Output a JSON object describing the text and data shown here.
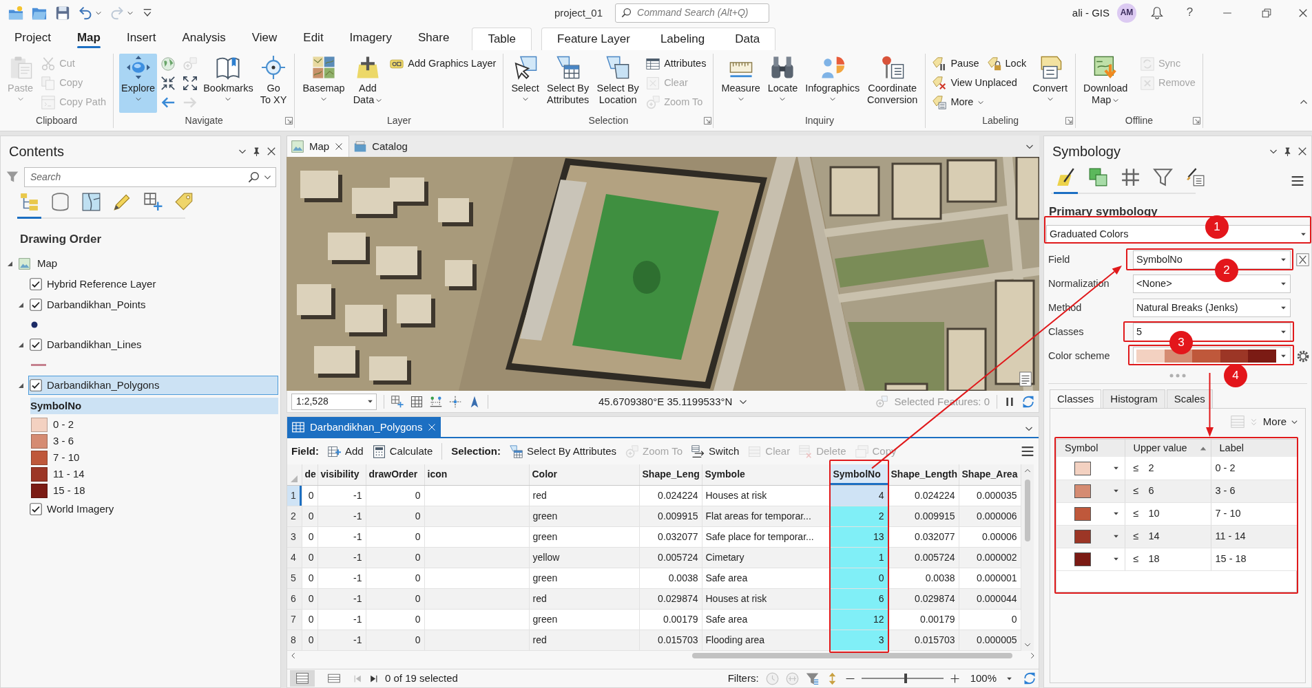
{
  "title_bar": {
    "project": "project_01",
    "command_search": {
      "placeholder": "Command Search (Alt+Q)"
    },
    "user": "ali - GIS",
    "avatar": "AM",
    "help": "?"
  },
  "ribbon_tabs": [
    {
      "label": "Project",
      "selected": false
    },
    {
      "label": "Map",
      "selected": true
    },
    {
      "label": "Insert",
      "selected": false
    },
    {
      "label": "Analysis",
      "selected": false
    },
    {
      "label": "View",
      "selected": false
    },
    {
      "label": "Edit",
      "selected": false
    },
    {
      "label": "Imagery",
      "selected": false
    },
    {
      "label": "Share",
      "selected": false
    }
  ],
  "contextual_tab_groups": [
    [
      {
        "label": "Table",
        "selected": false
      }
    ],
    [
      {
        "label": "Feature Layer",
        "selected": false
      },
      {
        "label": "Labeling",
        "selected": false
      },
      {
        "label": "Data",
        "selected": false
      }
    ]
  ],
  "ribbon_groups": [
    {
      "name": "Clipboard",
      "launcher": false,
      "items": [
        {
          "kind": "large",
          "label": "Paste",
          "disabled": true,
          "active": false,
          "dropdown": true
        },
        {
          "kind": "stack",
          "rows": [
            [
              {
                "label": "Cut",
                "disabled": true
              }
            ],
            [
              {
                "label": "Copy",
                "disabled": true
              }
            ],
            [
              {
                "label": "Copy Path",
                "disabled": true
              }
            ]
          ]
        }
      ]
    },
    {
      "name": "Navigate",
      "launcher": true,
      "items": [
        {
          "kind": "large",
          "label": "Explore",
          "disabled": false,
          "active": true,
          "dropdown": true
        },
        {
          "kind": "stack",
          "rows": [
            [
              {
                "disabled": false
              },
              {
                "disabled": true
              }
            ],
            [
              {
                "disabled": false
              },
              {
                "disabled": false
              }
            ],
            [
              {
                "disabled": false
              },
              {
                "disabled": true
              }
            ]
          ]
        },
        {
          "kind": "large",
          "label": "Bookmarks",
          "disabled": false,
          "active": false,
          "dropdown": true
        },
        {
          "kind": "large",
          "label": "Go\nTo XY",
          "disabled": false,
          "active": false,
          "dropdown": false
        }
      ]
    },
    {
      "name": "Layer",
      "launcher": false,
      "items": [
        {
          "kind": "large",
          "label": "Basemap",
          "disabled": false,
          "active": false,
          "dropdown": true
        },
        {
          "kind": "large",
          "label": "Add\nData",
          "disabled": false,
          "active": false,
          "dropdown": true
        },
        {
          "kind": "stack",
          "rows": [
            [
              {
                "label": "Add Graphics Layer",
                "disabled": false
              }
            ]
          ]
        }
      ]
    },
    {
      "name": "Selection",
      "launcher": true,
      "items": [
        {
          "kind": "large",
          "label": "Select",
          "disabled": false,
          "active": false,
          "dropdown": true
        },
        {
          "kind": "large",
          "label": "Select By\nAttributes",
          "disabled": false,
          "active": false,
          "dropdown": false
        },
        {
          "kind": "large",
          "label": "Select By\nLocation",
          "disabled": false,
          "active": false,
          "dropdown": false
        },
        {
          "kind": "stack",
          "rows": [
            [
              {
                "label": "Attributes",
                "disabled": false
              }
            ],
            [
              {
                "label": "Clear",
                "disabled": true
              }
            ],
            [
              {
                "label": "Zoom To",
                "disabled": true
              }
            ]
          ]
        }
      ]
    },
    {
      "name": "Inquiry",
      "launcher": false,
      "items": [
        {
          "kind": "large",
          "label": "Measure",
          "disabled": false,
          "active": false,
          "dropdown": true
        },
        {
          "kind": "large",
          "label": "Locate",
          "disabled": false,
          "active": false,
          "dropdown": true
        },
        {
          "kind": "large",
          "label": "Infographics",
          "disabled": false,
          "active": false,
          "dropdown": true
        },
        {
          "kind": "large",
          "label": "Coordinate\nConversion",
          "disabled": false,
          "active": false,
          "dropdown": false
        }
      ]
    },
    {
      "name": "Labeling",
      "launcher": true,
      "items": [
        {
          "kind": "stack",
          "rows": [
            [
              {
                "label": "Pause",
                "disabled": false
              },
              {
                "label": "Lock",
                "disabled": false
              }
            ],
            [
              {
                "label": "View Unplaced",
                "disabled": false
              }
            ],
            [
              {
                "label": "More",
                "disabled": false,
                "dropdown": true
              }
            ]
          ]
        },
        {
          "kind": "large",
          "label": "Convert",
          "disabled": false,
          "active": false,
          "dropdown": true
        }
      ]
    },
    {
      "name": "Offline",
      "launcher": true,
      "items": [
        {
          "kind": "large",
          "label": "Download\nMap",
          "disabled": false,
          "active": false,
          "dropdown": true
        },
        {
          "kind": "stack",
          "rows": [
            [
              {
                "label": "Sync",
                "disabled": true
              }
            ],
            [
              {
                "label": "Remove",
                "disabled": true
              }
            ]
          ]
        }
      ]
    }
  ],
  "contents": {
    "title": "Contents",
    "search": {
      "placeholder": "Search"
    },
    "view_tabs": [
      {
        "selected": true
      },
      {
        "selected": false
      },
      {
        "selected": false
      },
      {
        "selected": false
      },
      {
        "selected": false
      },
      {
        "selected": false
      }
    ],
    "heading": "Drawing Order",
    "tree": [
      {
        "name": "Map",
        "kind": "map",
        "expanded": true,
        "selected": false,
        "children": [
          {
            "name": "Hybrid Reference Layer",
            "kind": "layer",
            "checked": true,
            "selected": false
          },
          {
            "name": "Darbandikhan_Points",
            "kind": "layer",
            "checked": true,
            "expanded": true,
            "selected": false,
            "legend": {
              "kind": "point",
              "color": "#1c2b66"
            }
          },
          {
            "name": "Darbandikhan_Lines",
            "kind": "layer",
            "checked": true,
            "expanded": true,
            "selected": false,
            "legend": {
              "kind": "line",
              "color": "#c4808e"
            }
          },
          {
            "name": "Darbandikhan_Polygons",
            "kind": "layer",
            "checked": true,
            "expanded": true,
            "selected": true,
            "legend": {
              "kind": "classes",
              "field": "SymbolNo",
              "classes": [
                {
                  "label": "0 - 2",
                  "color": "#f3d1c1"
                },
                {
                  "label": "3 - 6",
                  "color": "#d58b72"
                },
                {
                  "label": "7 - 10",
                  "color": "#bf583b"
                },
                {
                  "label": "11 - 14",
                  "color": "#9c3626"
                },
                {
                  "label": "15 - 18",
                  "color": "#7b1b14"
                }
              ]
            }
          },
          {
            "name": "World Imagery",
            "kind": "layer",
            "checked": true,
            "selected": false
          }
        ]
      }
    ]
  },
  "map_view": {
    "tabs": [
      {
        "label": "Map",
        "selected": true,
        "closable": true
      },
      {
        "label": "Catalog",
        "selected": false,
        "closable": false
      }
    ],
    "scale": "1:2,528",
    "coordinates": "45.6709380°E 35.1199533°N",
    "selected_features": "Selected Features: 0"
  },
  "table_view": {
    "tab": {
      "label": "Darbandikhan_Polygons",
      "selected": true
    },
    "field_label": "Field:",
    "field_commands": [
      {
        "label": "Add",
        "disabled": false
      },
      {
        "label": "Calculate",
        "disabled": false
      }
    ],
    "selection_label": "Selection:",
    "selection_commands": [
      {
        "label": "Select By Attributes",
        "disabled": false
      },
      {
        "label": "Zoom To",
        "disabled": true
      },
      {
        "label": "Switch",
        "disabled": false
      },
      {
        "label": "Clear",
        "disabled": true
      },
      {
        "label": "Delete",
        "disabled": true
      },
      {
        "label": "Copy",
        "disabled": true
      }
    ],
    "columns": [
      {
        "label": "de",
        "kind": "number",
        "selected": false,
        "highlighted": false
      },
      {
        "label": "visibility",
        "kind": "number",
        "selected": false,
        "highlighted": false
      },
      {
        "label": "drawOrder",
        "kind": "number",
        "selected": false,
        "highlighted": false
      },
      {
        "label": "icon",
        "kind": "text",
        "selected": false,
        "highlighted": false
      },
      {
        "label": "Color",
        "kind": "text",
        "selected": false,
        "highlighted": false
      },
      {
        "label": "Shape_Leng",
        "kind": "number",
        "selected": false,
        "highlighted": false
      },
      {
        "label": "Symbole",
        "kind": "text",
        "selected": false,
        "highlighted": false
      },
      {
        "label": "SymbolNo",
        "kind": "number",
        "selected": true,
        "highlighted": true,
        "arrow": true
      },
      {
        "label": "Shape_Length",
        "kind": "number",
        "selected": false,
        "highlighted": false
      },
      {
        "label": "Shape_Area",
        "kind": "number",
        "selected": false,
        "highlighted": false
      }
    ],
    "rows": [
      {
        "number": "1",
        "current": true,
        "cells": [
          "0",
          "-1",
          "0",
          null,
          "red",
          "0.024224",
          "Houses at risk",
          "4",
          "0.024224",
          "0.000035"
        ]
      },
      {
        "number": "2",
        "current": false,
        "cells": [
          "0",
          "-1",
          "0",
          null,
          "green",
          "0.009915",
          "Flat areas for temporar...",
          "2",
          "0.009915",
          "0.000006"
        ]
      },
      {
        "number": "3",
        "current": false,
        "cells": [
          "0",
          "-1",
          "0",
          null,
          "green",
          "0.032077",
          "Safe place for temporar...",
          "13",
          "0.032077",
          "0.00006"
        ]
      },
      {
        "number": "4",
        "current": false,
        "cells": [
          "0",
          "-1",
          "0",
          null,
          "yellow",
          "0.005724",
          "Cimetary",
          "1",
          "0.005724",
          "0.000002"
        ]
      },
      {
        "number": "5",
        "current": false,
        "cells": [
          "0",
          "-1",
          "0",
          null,
          "green",
          "0.0038",
          "Safe area",
          "0",
          "0.0038",
          "0.000001"
        ]
      },
      {
        "number": "6",
        "current": false,
        "cells": [
          "0",
          "-1",
          "0",
          null,
          "red",
          "0.029874",
          "Houses at risk",
          "6",
          "0.029874",
          "0.000044"
        ]
      },
      {
        "number": "7",
        "current": false,
        "cells": [
          "0",
          "-1",
          "0",
          null,
          "green",
          "0.00179",
          "Safe area",
          "12",
          "0.00179",
          "0"
        ]
      },
      {
        "number": "8",
        "current": false,
        "cells": [
          "0",
          "-1",
          "0",
          null,
          "red",
          "0.015703",
          "Flooding area",
          "3",
          "0.015703",
          "0.000005"
        ]
      }
    ],
    "view_buttons": [
      {
        "selected": true
      },
      {
        "selected": false
      }
    ],
    "selection_count": "0 of 19 selected",
    "filters_label": "Filters:",
    "zoom": {
      "level": 0.54,
      "value": "100%"
    }
  },
  "symbology": {
    "title": "Symbology",
    "view_tabs": [
      {
        "selected": true
      },
      {
        "selected": false
      },
      {
        "selected": false
      },
      {
        "selected": false
      },
      {
        "selected": false
      }
    ],
    "heading": "Primary symbology",
    "renderer": {
      "value": "Graduated Colors",
      "marker": "1"
    },
    "settings": [
      {
        "label": "Field",
        "kind": "dropdown",
        "value": "SymbolNo",
        "marker": "2",
        "expression_button": true
      },
      {
        "label": "Normalization",
        "kind": "dropdown",
        "value": "<None>"
      },
      {
        "label": "Method",
        "kind": "dropdown",
        "value": "Natural Breaks (Jenks)"
      },
      {
        "label": "Classes",
        "kind": "dropdown",
        "value": "5",
        "marker": "3"
      },
      {
        "label": "Color scheme",
        "kind": "ramp",
        "ramp": [
          {
            "color": "#f3d1c1"
          },
          {
            "color": "#d58b72"
          },
          {
            "color": "#bf583b"
          },
          {
            "color": "#9c3626"
          },
          {
            "color": "#7b1b14"
          }
        ],
        "marker": "4",
        "settings_button": true,
        "arrow": true
      }
    ],
    "tabs": [
      {
        "label": "Classes",
        "selected": true
      },
      {
        "label": "Histogram",
        "selected": false
      },
      {
        "label": "Scales",
        "selected": false
      }
    ],
    "more": "More",
    "classes_table": {
      "highlighted": true,
      "columns": [
        {
          "label": "Symbol",
          "sorted": false
        },
        {
          "label": "Upper value",
          "sorted": true
        },
        {
          "label": "Label",
          "sorted": false
        }
      ],
      "rows": [
        {
          "color": "#f3d1c1",
          "operator": "≤",
          "upper": "2",
          "label": "0 - 2"
        },
        {
          "color": "#d58b72",
          "operator": "≤",
          "upper": "6",
          "label": "3 - 6"
        },
        {
          "color": "#bf583b",
          "operator": "≤",
          "upper": "10",
          "label": "7 - 10"
        },
        {
          "color": "#9c3626",
          "operator": "≤",
          "upper": "14",
          "label": "11 - 14"
        },
        {
          "color": "#7b1b14",
          "operator": "≤",
          "upper": "18",
          "label": "15 - 18"
        }
      ]
    }
  }
}
